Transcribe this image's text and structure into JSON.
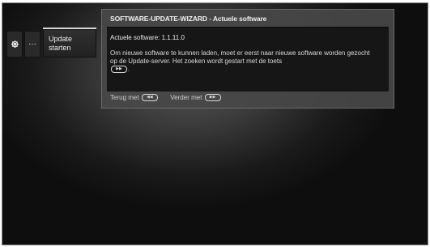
{
  "menu": {
    "settings_icon": "gear-icon",
    "more_label": "···",
    "update_line1": "Update",
    "update_line2": "starten"
  },
  "dialog": {
    "title": "SOFTWARE-UPDATE-WIZARD - Actuele software",
    "current_software": "Actuele software: 1.1.11.0",
    "body_text": "Om nieuwe software te kunnen laden, moet er eerst naar nieuwe software worden gezocht op de Update-server. Het zoeken wordt gestart met de toets",
    "body_end": ".",
    "back_label": "Terug met",
    "back_key_icon": "rewind-key-icon",
    "forward_label": "Verder met",
    "forward_key_icon": "fast-forward-key-icon"
  }
}
